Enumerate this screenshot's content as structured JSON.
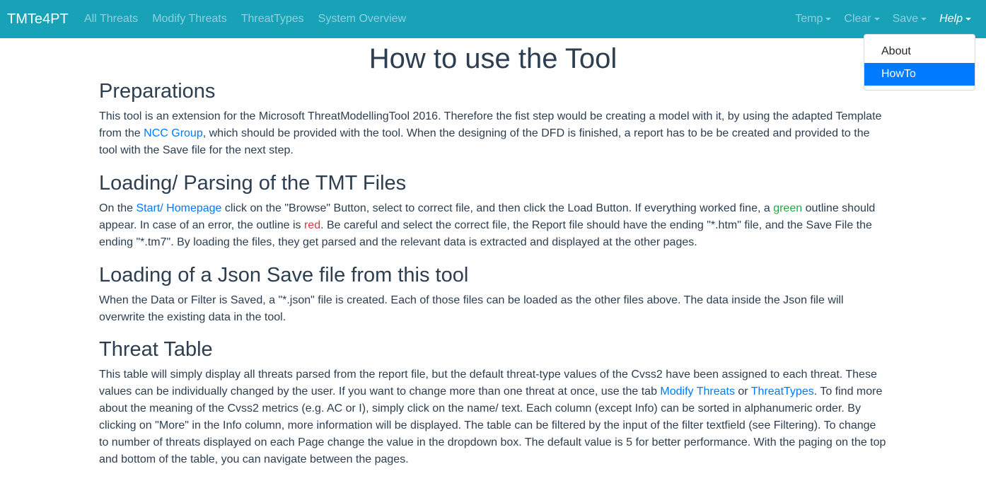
{
  "navbar": {
    "brand": "TMTe4PT",
    "links": [
      "All Threats",
      "Modify Threats",
      "ThreatTypes",
      "System Overview"
    ],
    "dropdowns": [
      "Temp",
      "Clear",
      "Save",
      "Help"
    ],
    "active_dropdown": "Help",
    "help_menu": {
      "items": [
        "About",
        "HowTo"
      ],
      "active_item": "HowTo"
    },
    "color": "#17a2b8"
  },
  "page": {
    "title": "How to use the Tool",
    "sections": [
      {
        "title": "Preparations",
        "text": {
          "p1": "This tool is an extension for the Microsoft ThreatModellingTool 2016. Therefore the fist step would be creating a model with it, by using the adapted Template from the ",
          "link1": "NCC Group",
          "p2": ", which should be provided with the tool. When the designing of the DFD is finished, a report has to be be created and provided to the tool with the Save file for the next step."
        }
      },
      {
        "title": "Loading/ Parsing of the TMT Files",
        "text": {
          "p1": "On the ",
          "link1": "Start/ Homepage",
          "p2": " click on the \"Browse\" Button, select to correct file, and then click the Load Button. If everything worked fine, a ",
          "green": "green",
          "p3": " outline should appear. In case of an error, the outline is ",
          "red": "red",
          "p4": ". Be careful and select the correct file, the Report file should have the ending \"*.htm\" file, and the Save File the ending \"*.tm7\". By loading the files, they get parsed and the relevant data is extracted and displayed at the other pages."
        }
      },
      {
        "title": "Loading of a Json Save file from this tool",
        "text": {
          "p1": "When the Data or Filter is Saved, a \"*.json\" file is created. Each of those files can be loaded as the other files above. The data inside the Json file will overwrite the existing data in the tool."
        }
      },
      {
        "title": "Threat Table",
        "text": {
          "p1": "This table will simply display all threats parsed from the report file, but the default threat-type values of the Cvss2 have been assigned to each threat. These values can be individually changed by the user. If you want to change more than one threat at once, use the tab ",
          "link1": "Modify Threats",
          "p2": " or ",
          "link2": "ThreatTypes",
          "p3": ". To find more about the meaning of the Cvss2 metrics (e.g. AC or I), simply click on the name/ text. Each column (except Info) can be sorted in alphanumeric order. By clicking on \"More\" in the Info column, more information will be displayed. The table can be filtered by the input of the filter textfield (see Filtering). To change to number of threats displayed on each Page change the value in the dropdown box. The default value is 5 for better performance. With the paging on the top and bottom of the table, you can navigate between the pages."
        }
      }
    ]
  }
}
